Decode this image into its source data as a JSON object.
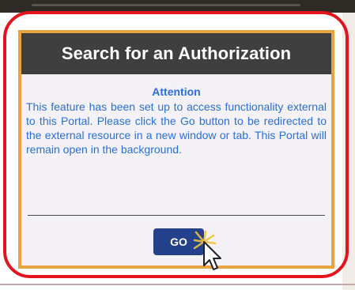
{
  "modal": {
    "title": "Search for an Authorization",
    "attention_heading": "Attention",
    "message": "This feature has been set up to access functionality external to this Portal. Please click the Go button to be redirected to the external resource in a new window or tab. This Portal will remain open in the background.",
    "go_label": "GO"
  },
  "icons": {
    "cursor": "mouse-pointer-arrow-icon"
  },
  "colors": {
    "header_background": "#3f3f3f",
    "modal_border": "#e9a341",
    "text_blue": "#2a6fd6",
    "button_blue": "#24418c",
    "highlight_ring": "#e3141b"
  }
}
